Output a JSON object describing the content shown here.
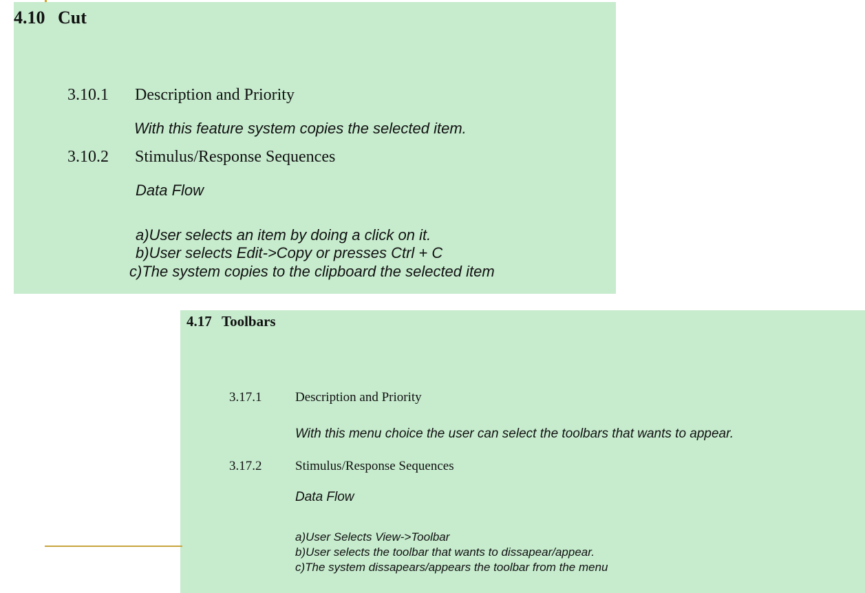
{
  "sections": [
    {
      "number": "4.10",
      "title": "Cut",
      "description_heading": {
        "number": "3.10.1",
        "label": "Description and Priority"
      },
      "description": "With this feature system copies the selected item.",
      "sequence_heading": {
        "number": "3.10.2",
        "label": "Stimulus/Response Sequences"
      },
      "data_flow_label": "Data Flow",
      "steps": [
        "a)User selects an item by doing a click on it.",
        "b)User selects Edit->Copy or presses Ctrl + C",
        "c)The system copies to the clipboard the selected item"
      ]
    },
    {
      "number": "4.17",
      "title": "Toolbars",
      "description_heading": {
        "number": "3.17.1",
        "label": "Description and Priority"
      },
      "description": "With this menu choice the user can select the toolbars that wants to appear.",
      "sequence_heading": {
        "number": "3.17.2",
        "label": "Stimulus/Response Sequences"
      },
      "data_flow_label": "Data Flow",
      "steps": [
        "a)User Selects View->Toolbar",
        "b)User selects the toolbar that wants to dissapear/appear.",
        "c)The system dissapears/appears the toolbar from the menu"
      ]
    }
  ],
  "colors": {
    "panel_background": "#c6ebcd",
    "accent": "#d5a21f",
    "text": "#111111"
  }
}
